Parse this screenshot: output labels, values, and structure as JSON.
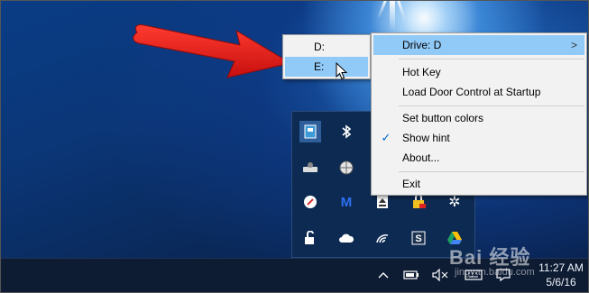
{
  "drive_submenu": {
    "items": [
      {
        "label": "D:",
        "highlighted": false
      },
      {
        "label": "E:",
        "highlighted": true
      }
    ]
  },
  "context_menu": {
    "items": [
      {
        "label": "Drive: D",
        "highlighted": true,
        "has_submenu": true,
        "checked": false
      },
      {
        "label": "Hot Key",
        "highlighted": false,
        "has_submenu": false,
        "checked": false
      },
      {
        "label": "Load Door Control at Startup",
        "highlighted": false,
        "has_submenu": false,
        "checked": false
      },
      {
        "label": "Set button colors",
        "highlighted": false,
        "has_submenu": false,
        "checked": false
      },
      {
        "label": "Show hint",
        "highlighted": false,
        "has_submenu": false,
        "checked": true
      },
      {
        "label": "About...",
        "highlighted": false,
        "has_submenu": false,
        "checked": false
      },
      {
        "label": "Exit",
        "highlighted": false,
        "has_submenu": false,
        "checked": false
      }
    ],
    "submenu_arrow": ">",
    "check_mark": "✓"
  },
  "tray_flyout": {
    "icons": [
      "door-control-icon",
      "bluetooth-icon",
      "usb-drive-icon",
      "network-globe-icon",
      "pin-icon",
      "malwarebytes-icon",
      "eject-drive-icon",
      "security-lock-icon",
      "unlock-icon",
      "onedrive-icon",
      "wifi-icon",
      "sync-s-icon",
      "google-drive-icon",
      "settings-gear-icon"
    ]
  },
  "taskbar": {
    "time": "11:27 AM",
    "date": "5/6/16",
    "icons": [
      "show-hidden-icons-chevron",
      "battery-icon",
      "volume-muted-icon",
      "keyboard-icon",
      "action-center-icon"
    ]
  },
  "watermark": {
    "main": "Bai 经验",
    "sub": "jingyan.baidu.com"
  },
  "colors": {
    "menu_highlight": "#91c9f7",
    "menu_background": "#f2f2f2",
    "annotation_arrow": "#e41e1e",
    "taskbar": "#0d1b33"
  }
}
